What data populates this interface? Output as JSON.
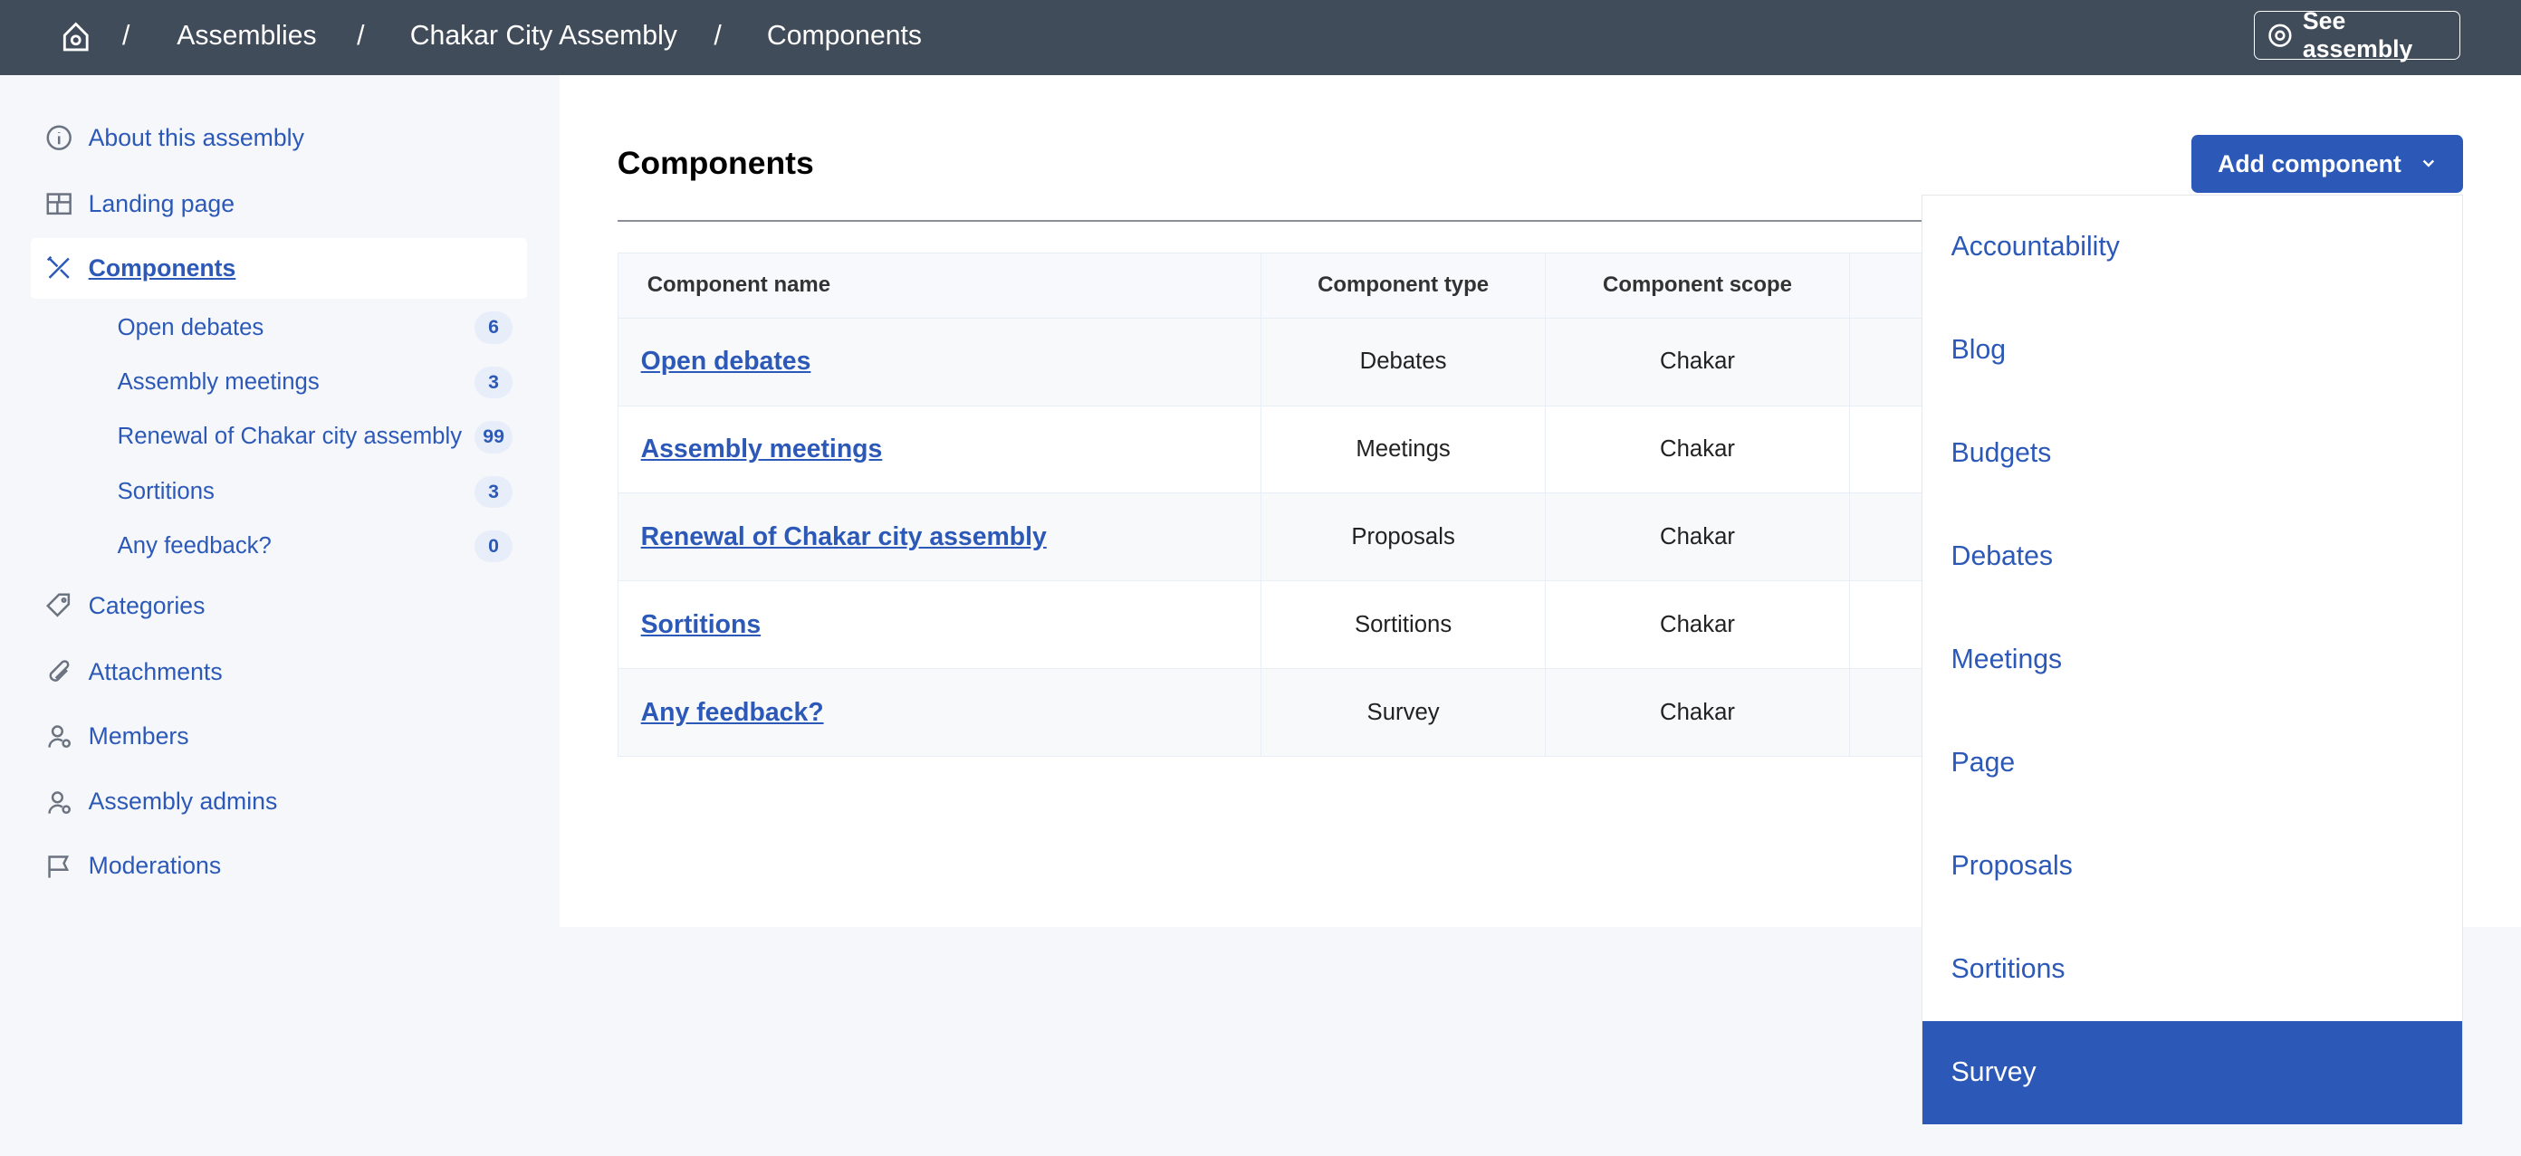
{
  "header": {
    "breadcrumbs": [
      "Assemblies",
      "Chakar City Assembly",
      "Components"
    ],
    "separator": "/",
    "see_assembly": "See assembly"
  },
  "sidebar": {
    "items": [
      {
        "label": "About this assembly",
        "icon": "info-icon"
      },
      {
        "label": "Landing page",
        "icon": "layout-icon"
      },
      {
        "label": "Components",
        "icon": "tools-icon",
        "active": true
      },
      {
        "label": "Categories",
        "icon": "tag-icon"
      },
      {
        "label": "Attachments",
        "icon": "paperclip-icon"
      },
      {
        "label": "Members",
        "icon": "user-gear-icon"
      },
      {
        "label": "Assembly admins",
        "icon": "user-gear-icon"
      },
      {
        "label": "Moderations",
        "icon": "flag-icon"
      }
    ],
    "components": [
      {
        "label": "Open debates",
        "count": "6"
      },
      {
        "label": "Assembly meetings",
        "count": "3"
      },
      {
        "label": "Renewal of Chakar city assembly",
        "count": "99"
      },
      {
        "label": "Sortitions",
        "count": "3"
      },
      {
        "label": "Any feedback?",
        "count": "0"
      }
    ]
  },
  "main": {
    "title": "Components",
    "add_button": "Add component",
    "table": {
      "headers": [
        "Component name",
        "Component type",
        "Component scope"
      ],
      "rows": [
        [
          "Open debates",
          "Debates",
          "Chakar"
        ],
        [
          "Assembly meetings",
          "Meetings",
          "Chakar"
        ],
        [
          "Renewal of Chakar city assembly",
          "Proposals",
          "Chakar"
        ],
        [
          "Sortitions",
          "Sortitions",
          "Chakar"
        ],
        [
          "Any feedback?",
          "Survey",
          "Chakar"
        ]
      ]
    },
    "dropdown": {
      "items": [
        "Accountability",
        "Blog",
        "Budgets",
        "Debates",
        "Meetings",
        "Page",
        "Proposals",
        "Sortitions",
        "Survey"
      ],
      "highlighted": "Survey"
    }
  },
  "colors": {
    "header": "#414c5a",
    "accent": "#2c59b8",
    "sidebar_bg": "#f5f7fa"
  }
}
